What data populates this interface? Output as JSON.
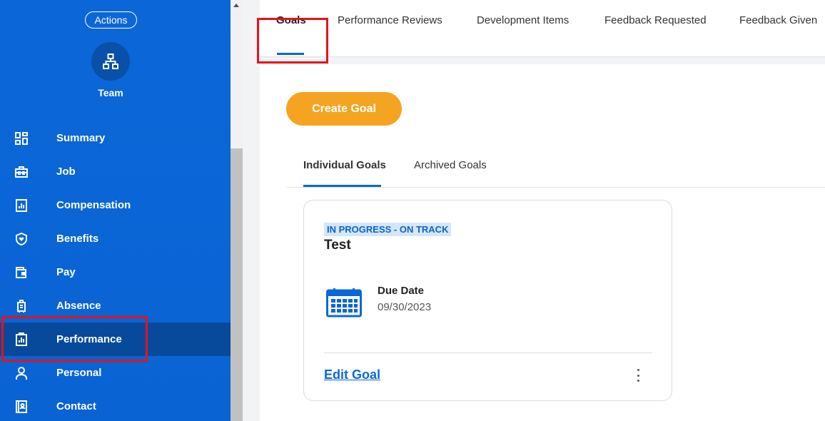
{
  "sidebar": {
    "actions_label": "Actions",
    "team_label": "Team",
    "items": [
      {
        "label": "Summary",
        "icon": "dashboard-icon"
      },
      {
        "label": "Job",
        "icon": "briefcase-icon"
      },
      {
        "label": "Compensation",
        "icon": "compensation-icon"
      },
      {
        "label": "Benefits",
        "icon": "shield-heart-icon"
      },
      {
        "label": "Pay",
        "icon": "wallet-icon"
      },
      {
        "label": "Absence",
        "icon": "luggage-icon"
      },
      {
        "label": "Performance",
        "icon": "clipboard-chart-icon",
        "active": true
      },
      {
        "label": "Personal",
        "icon": "person-icon"
      },
      {
        "label": "Contact",
        "icon": "contact-book-icon"
      }
    ]
  },
  "tabs": [
    {
      "label": "Goals",
      "active": true
    },
    {
      "label": "Performance Reviews"
    },
    {
      "label": "Development Items"
    },
    {
      "label": "Feedback Requested"
    },
    {
      "label": "Feedback Given"
    }
  ],
  "create_goal_label": "Create Goal",
  "subtabs": [
    {
      "label": "Individual Goals",
      "active": true
    },
    {
      "label": "Archived Goals"
    }
  ],
  "goal_card": {
    "status": "IN PROGRESS - ON TRACK",
    "title": "Test",
    "due_label": "Due Date",
    "due_value": "09/30/2023",
    "edit_label": "Edit Goal"
  },
  "colors": {
    "sidebar_bg": "#0b67d8",
    "active_bg": "#074a9c",
    "accent": "#0b67d8",
    "button_orange": "#f5a422",
    "highlight_red": "#e8121b"
  }
}
